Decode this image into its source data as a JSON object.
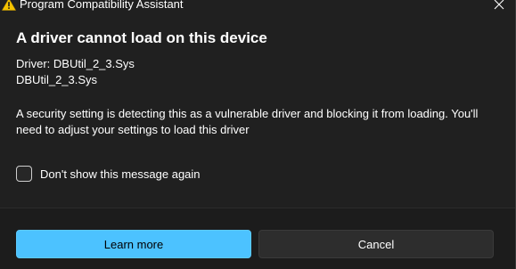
{
  "window": {
    "title": "Program Compatibility Assistant",
    "title_icon": "warning-icon",
    "close_icon": "close-icon"
  },
  "dialog": {
    "heading": "A driver cannot load on this device",
    "driver_line1": "Driver: DBUtil_2_3.Sys",
    "driver_line2": "DBUtil_2_3.Sys",
    "description": "A security setting is detecting this as a vulnerable driver and blocking it from loading. You'll need to adjust your settings to load this driver",
    "checkbox_label": "Don't show this message again",
    "checkbox_checked": false
  },
  "buttons": {
    "learn_more": "Learn more",
    "cancel": "Cancel"
  },
  "colors": {
    "background": "#202020",
    "footer": "#1c1c1c",
    "accent": "#4cc2ff",
    "warning": "#f5c400"
  }
}
